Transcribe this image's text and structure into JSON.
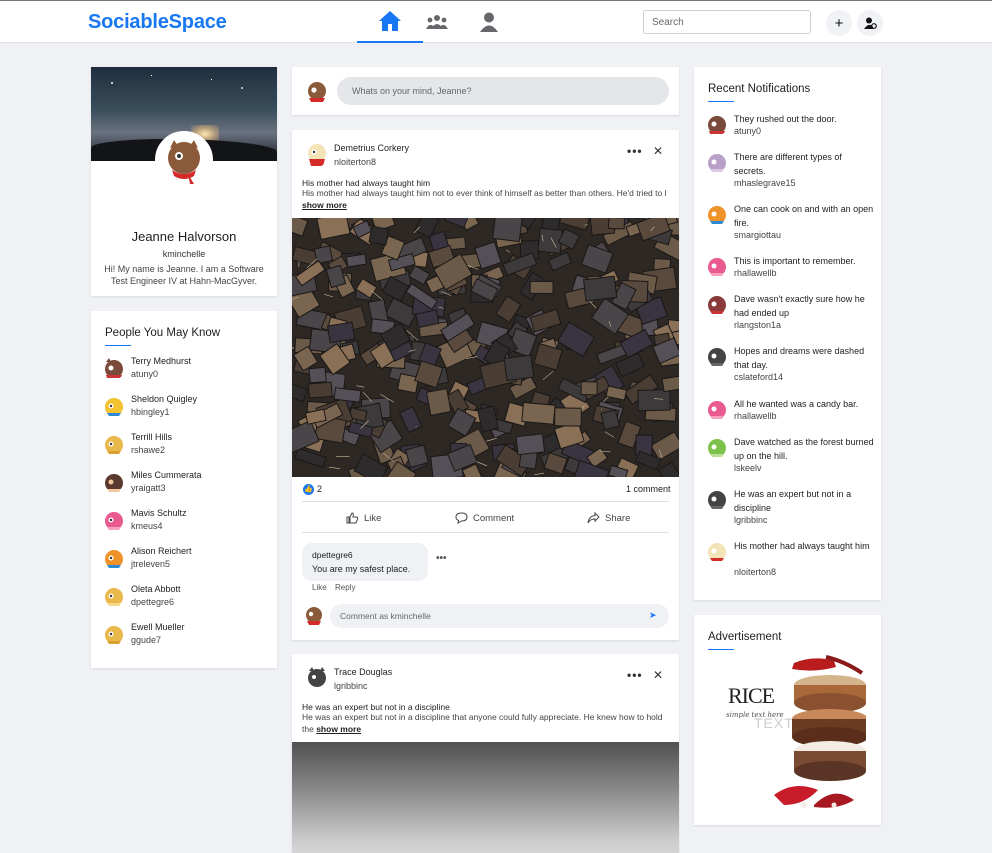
{
  "app": {
    "name": "SociableSpace"
  },
  "header": {
    "search_placeholder": "Search",
    "add_label": "+"
  },
  "profile": {
    "name": "Jeanne Halvorson",
    "username": "kminchelle",
    "bio": "Hi! My name is Jeanne. I am a Software Test Engineer IV at Hahn-MacGyver."
  },
  "people": {
    "title": "People You May Know",
    "items": [
      {
        "name": "Terry Medhurst",
        "username": "atuny0"
      },
      {
        "name": "Sheldon Quigley",
        "username": "hbingley1"
      },
      {
        "name": "Terrill Hills",
        "username": "rshawe2"
      },
      {
        "name": "Miles Cummerata",
        "username": "yraigatt3"
      },
      {
        "name": "Mavis Schultz",
        "username": "kmeus4"
      },
      {
        "name": "Alison Reichert",
        "username": "jtreleven5"
      },
      {
        "name": "Oleta Abbott",
        "username": "dpettegre6"
      },
      {
        "name": "Ewell Mueller",
        "username": "ggude7"
      }
    ]
  },
  "composer": {
    "placeholder": "Whats on your mind, Jeanne?"
  },
  "posts": [
    {
      "author": "Demetrius Corkery",
      "username": "nloiterton8",
      "title": "His mother had always taught him",
      "body": "His mother had always taught him not to ever think of himself as better than others. He'd tried to l",
      "show_more": "show more",
      "likes": "2",
      "comments": "1 comment",
      "actions": {
        "like": "Like",
        "comment": "Comment",
        "share": "Share"
      },
      "comment": {
        "username": "dpettegre6",
        "text": "You are my safest place.",
        "like": "Like",
        "reply": "Reply"
      },
      "comment_placeholder": "Comment as kminchelle"
    },
    {
      "author": "Trace Douglas",
      "username": "lgribbinc",
      "title": "He was an expert but not in a discipline",
      "body": "He was an expert but not in a discipline that anyone could fully appreciate. He knew how to hold the",
      "show_more": "show more"
    }
  ],
  "notifications": {
    "title": "Recent Notifications",
    "items": [
      {
        "text": "They rushed out the door.",
        "username": "atuny0"
      },
      {
        "text": "There are different types of secrets.",
        "username": "mhaslegrave15"
      },
      {
        "text": "One can cook on and with an open fire.",
        "username": "smargiottau"
      },
      {
        "text": "This is important to remember.",
        "username": "rhallawellb"
      },
      {
        "text": "Dave wasn't exactly sure how he had ended up",
        "username": "rlangston1a"
      },
      {
        "text": "Hopes and dreams were dashed that day.",
        "username": "cslateford14"
      },
      {
        "text": "All he wanted was a candy bar.",
        "username": "rhallawellb"
      },
      {
        "text": "Dave watched as the forest burned up on the hill.",
        "username": "lskeelv"
      },
      {
        "text": "He was an expert but not in a discipline",
        "username": "lgribbinc"
      },
      {
        "text": "His mother had always taught him",
        "username": "nloiterton8"
      }
    ]
  },
  "advertisement": {
    "title": "Advertisement",
    "brand": "RICE",
    "tagline": "simple text here",
    "subtext": "TEXT"
  },
  "colors": {
    "brand": "#1877f2",
    "background": "#eff1f5"
  }
}
